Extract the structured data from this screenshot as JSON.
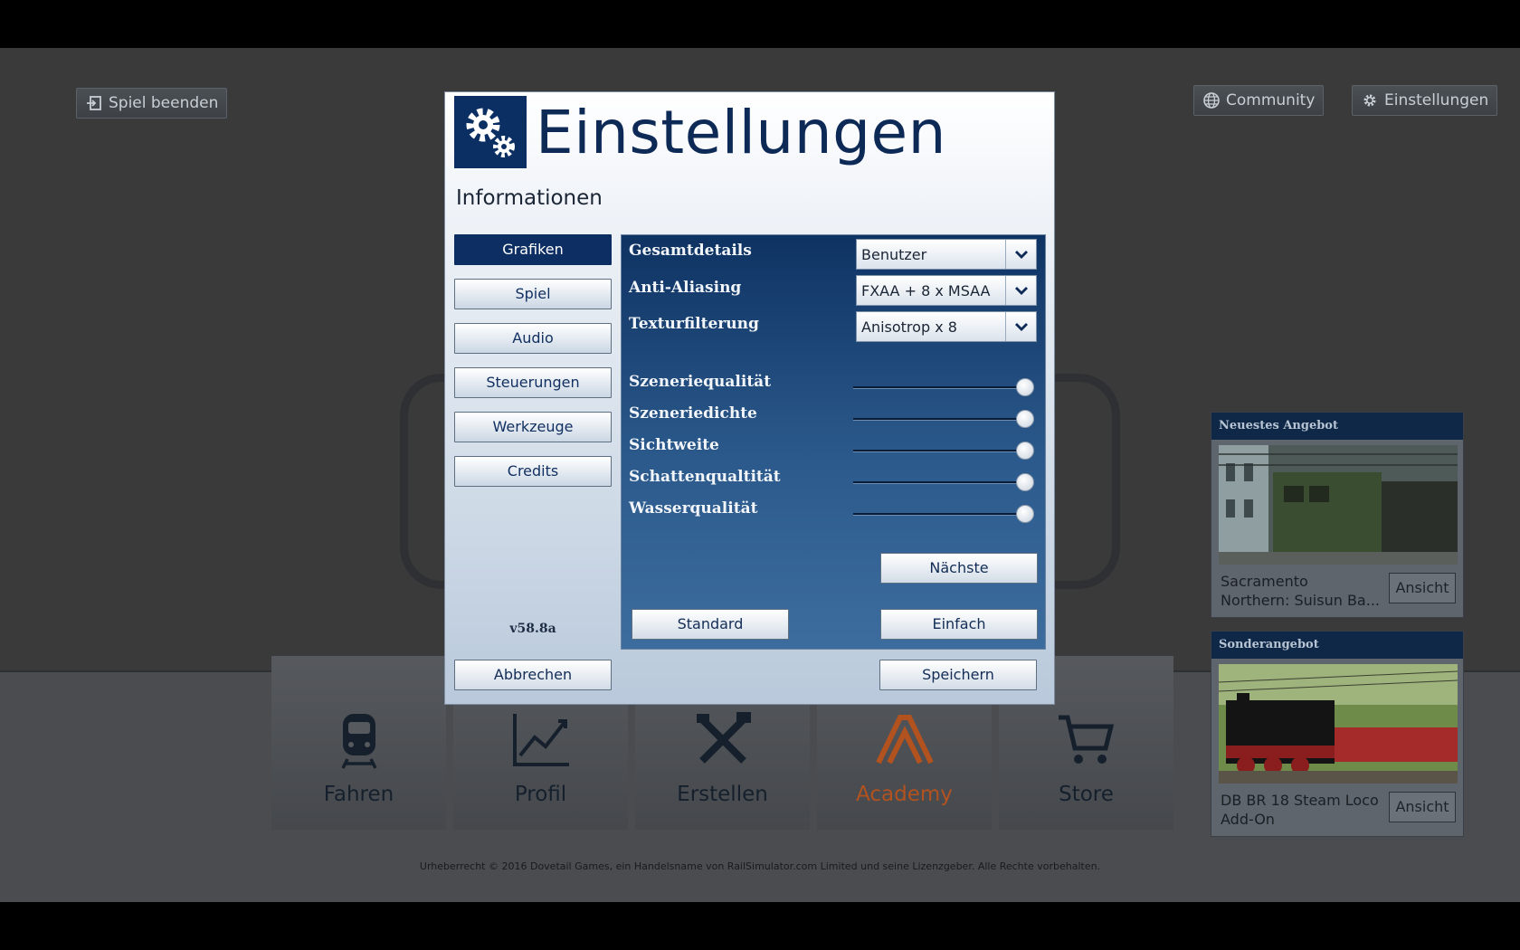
{
  "topbar": {
    "quit_label": "Spiel beenden",
    "community_label": "Community",
    "settings_label": "Einstellungen"
  },
  "main_menu": {
    "tiles": [
      {
        "label": "Fahren",
        "icon": "train-icon"
      },
      {
        "label": "Profil",
        "icon": "chart-line-icon"
      },
      {
        "label": "Erstellen",
        "icon": "tools-icon"
      },
      {
        "label": "Academy",
        "icon": "academy-icon"
      },
      {
        "label": "Store",
        "icon": "shopping-cart-icon"
      }
    ]
  },
  "offers": {
    "newest": {
      "header": "Neuestes Angebot",
      "title_line1": "Sacramento",
      "title_line2": "Northern: Suisun Ba...",
      "button": "Ansicht"
    },
    "special": {
      "header": "Sonderangebot",
      "title_line1": "DB BR 18 Steam Loco",
      "title_line2": "Add-On",
      "button": "Ansicht"
    }
  },
  "footer": {
    "copyright": "Urheberrecht © 2016 Dovetail Games, ein Handelsname von RailSimulator.com Limited und seine Lizenzgeber. Alle Rechte vorbehalten."
  },
  "dialog": {
    "title": "Einstellungen",
    "subtitle": "Informationen",
    "nav": [
      "Grafiken",
      "Spiel",
      "Audio",
      "Steuerungen",
      "Werkzeuge",
      "Credits"
    ],
    "active_nav": "Grafiken",
    "version": "v58.8a",
    "cancel_label": "Abbrechen",
    "save_label": "Speichern",
    "graphics": {
      "dropdowns": [
        {
          "label": "Gesamtdetails",
          "value": "Benutzer"
        },
        {
          "label": "Anti-Aliasing",
          "value": "FXAA + 8 x MSAA"
        },
        {
          "label": "Texturfilterung",
          "value": "Anisotrop x 8"
        }
      ],
      "sliders": [
        {
          "label": "Szeneriequalität",
          "level": 1.0
        },
        {
          "label": "Szeneriedichte",
          "level": 1.0
        },
        {
          "label": "Sichtweite",
          "level": 1.0
        },
        {
          "label": "Schattenqualtität",
          "level": 1.0
        },
        {
          "label": "Wasserqualität",
          "level": 1.0
        }
      ],
      "next_label": "Nächste",
      "standard_label": "Standard",
      "simple_label": "Einfach"
    }
  },
  "colors": {
    "dialog_title": "#0d2a57",
    "panel_top": "#0e3363",
    "panel_bottom": "#3d6c9f",
    "active_nav": "#0c2e63",
    "academy_orange": "#b2521f"
  }
}
